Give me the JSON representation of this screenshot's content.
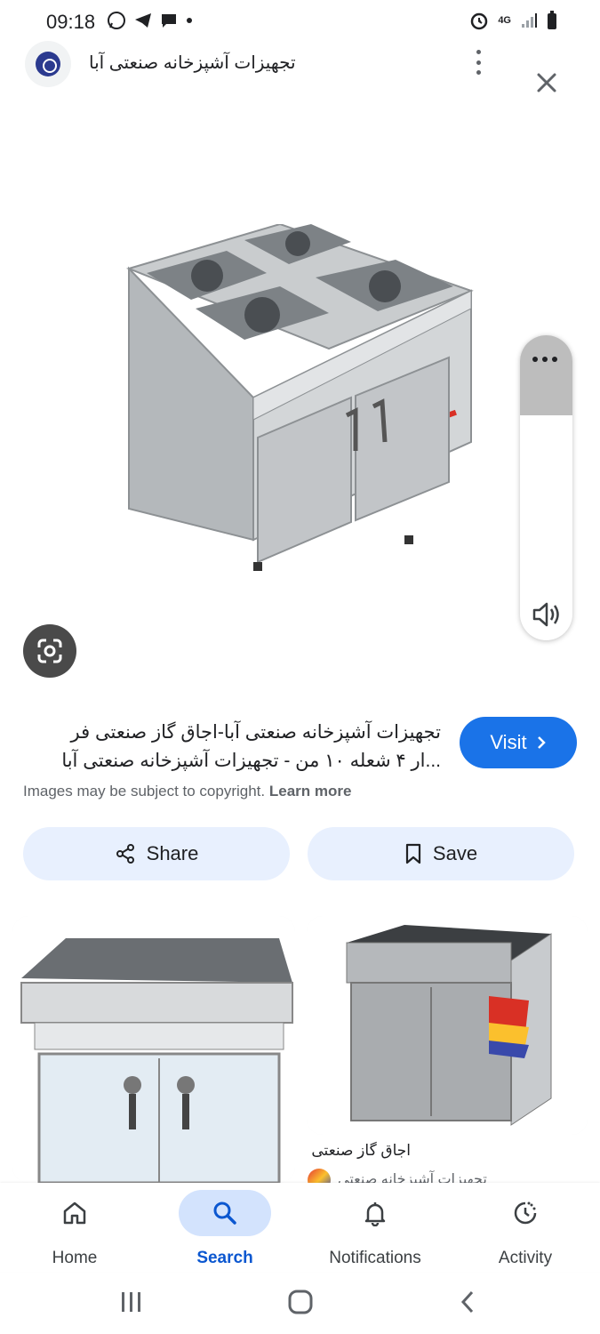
{
  "status_bar": {
    "time": "09:18",
    "network": "4G"
  },
  "header": {
    "site_title": "تجهیزات آشپزخانه صنعتی آبا",
    "logo_icon": "site-logo",
    "more_icon": "more-vert-icon",
    "close_icon": "close-icon"
  },
  "image_viewer": {
    "lens_icon": "google-lens-icon",
    "side_panel_icon": "more-horiz-icon",
    "volume_icon": "volume-icon"
  },
  "result": {
    "title_line1": "تجهیزات آشپزخانه صنعتی آبا-اجاق گاز صنعتی فر",
    "title_line2": "...ار ۴ شعله ۱۰ من - تجهیزات آشپزخانه صنعتی آبا",
    "visit_label": "Visit",
    "copyright_text": "Images may be subject to copyright.",
    "learn_more": "Learn more"
  },
  "actions": {
    "share_label": "Share",
    "save_label": "Save"
  },
  "related": {
    "card2_title": "اجاق گاز صنعتی",
    "card2_source": "تجهیزات آشپزخانه صنعتی"
  },
  "bottom_nav": {
    "items": [
      {
        "label": "Home",
        "icon": "home-icon"
      },
      {
        "label": "Search",
        "icon": "search-icon",
        "active": true
      },
      {
        "label": "Notifications",
        "icon": "bell-icon"
      },
      {
        "label": "Activity",
        "icon": "activity-icon"
      }
    ]
  },
  "colors": {
    "accent": "#1a73e8",
    "chip_bg": "#e8f0fe",
    "nav_active": "#0b57d0"
  }
}
